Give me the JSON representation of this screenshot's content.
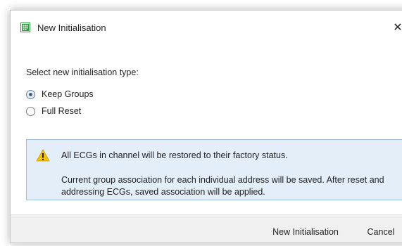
{
  "dialog": {
    "title": "New Initialisation",
    "close_glyph": "✕",
    "icon": "grid-app-icon",
    "prompt": "Select new initialisation type:",
    "options": [
      {
        "label": "Keep Groups",
        "checked": true
      },
      {
        "label": "Full Reset",
        "checked": false
      }
    ],
    "info": {
      "icon": "warning-icon",
      "line1": "All ECGs in channel will be restored to their factory status.",
      "line2": "Current group association for each individual address will be saved. After reset and addressing ECGs, saved association will be applied."
    },
    "buttons": {
      "primary": "New Initialisation",
      "cancel": "Cancel"
    },
    "colors": {
      "info_background": "#e4eef9",
      "info_border": "#9dbde0",
      "warning_fill": "#f5c400",
      "app_icon_green": "#2e9b3f"
    }
  }
}
